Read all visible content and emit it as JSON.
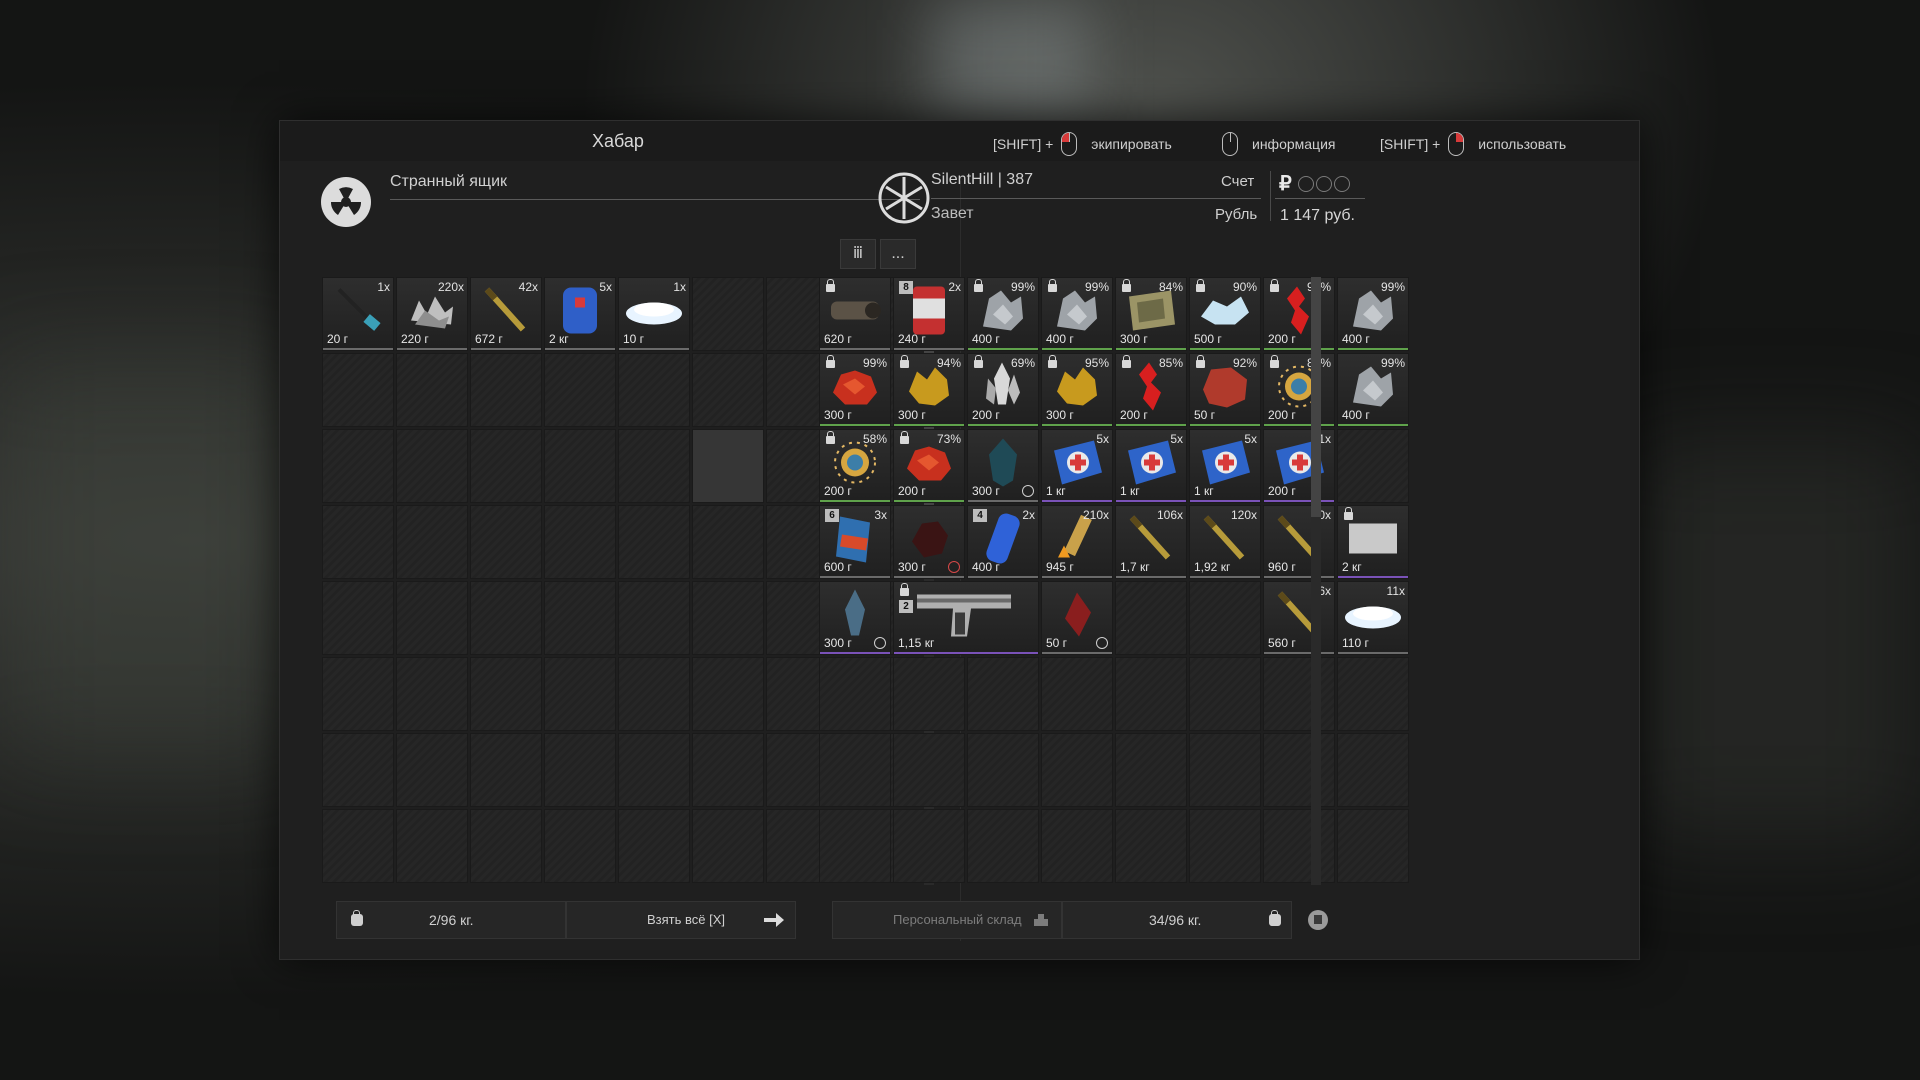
{
  "window": {
    "title": "Хабар",
    "hints": [
      {
        "prefix": "[SHIFT] +",
        "mouse": "left",
        "label": "экипировать"
      },
      {
        "prefix": "",
        "mouse": "none",
        "label": "информация"
      },
      {
        "prefix": "[SHIFT] +",
        "mouse": "right",
        "label": "использовать"
      }
    ]
  },
  "left_panel": {
    "icon": "radiation-icon",
    "name": "Странный ящик",
    "tool_sort": "ⅲ",
    "tool_more": "...",
    "weight": "2/96 кг.",
    "take_all": "Взять всё [X]",
    "items": [
      {
        "qty": "1x",
        "weight": "20 г",
        "kind": "antenna"
      },
      {
        "qty": "220x",
        "weight": "220 г",
        "kind": "scrap"
      },
      {
        "qty": "42x",
        "weight": "672 г",
        "kind": "ammo"
      },
      {
        "qty": "5x",
        "weight": "2 кг",
        "kind": "canister"
      },
      {
        "qty": "1x",
        "weight": "10 г",
        "kind": "salt"
      }
    ]
  },
  "right_panel": {
    "icon": "snowflake-icon",
    "player": "SilentHill | 387",
    "faction": "Завет",
    "account_label": "Счет",
    "currency_label": "Рубль",
    "currency_symbol": "₽",
    "money": "1 147 руб.",
    "storage": "Персональный склад",
    "weight": "34/96 кг.",
    "items": [
      {
        "qty": "",
        "weight": "620 г",
        "lock": true,
        "kind": "scope"
      },
      {
        "qty": "2x",
        "weight": "240 г",
        "badge": "8",
        "kind": "can"
      },
      {
        "qty": "99%",
        "weight": "400 г",
        "lock": true,
        "kind": "rock"
      },
      {
        "qty": "99%",
        "weight": "400 г",
        "lock": true,
        "kind": "rock"
      },
      {
        "qty": "84%",
        "weight": "300 г",
        "lock": true,
        "kind": "map"
      },
      {
        "qty": "90%",
        "weight": "500 г",
        "lock": true,
        "kind": "ice"
      },
      {
        "qty": "92%",
        "weight": "200 г",
        "lock": true,
        "kind": "redcrystal"
      },
      {
        "qty": "99%",
        "weight": "400 г",
        "kind": "rock"
      },
      {
        "qty": "99%",
        "weight": "300 г",
        "lock": true,
        "kind": "redblob"
      },
      {
        "qty": "94%",
        "weight": "300 г",
        "lock": true,
        "kind": "gold"
      },
      {
        "qty": "69%",
        "weight": "200 г",
        "lock": true,
        "kind": "crystal"
      },
      {
        "qty": "95%",
        "weight": "300 г",
        "lock": true,
        "kind": "gold"
      },
      {
        "qty": "85%",
        "weight": "200 г",
        "lock": true,
        "kind": "redcrystal"
      },
      {
        "qty": "92%",
        "weight": "50 г",
        "lock": true,
        "kind": "redrock"
      },
      {
        "qty": "89%",
        "weight": "200 г",
        "lock": true,
        "kind": "spark"
      },
      {
        "qty": "99%",
        "weight": "400 г",
        "kind": "rock"
      },
      {
        "qty": "58%",
        "weight": "200 г",
        "lock": true,
        "kind": "spark"
      },
      {
        "qty": "73%",
        "weight": "200 г",
        "lock": true,
        "kind": "redblob"
      },
      {
        "qty": "",
        "weight": "300 г",
        "clock": true,
        "kind": "shell"
      },
      {
        "qty": "5x",
        "weight": "1 кг",
        "kind": "medkit"
      },
      {
        "qty": "5x",
        "weight": "1 кг",
        "kind": "medkit"
      },
      {
        "qty": "5x",
        "weight": "1 кг",
        "kind": "medkit"
      },
      {
        "qty": "1x",
        "weight": "200 г",
        "kind": "medkit"
      },
      {
        "qty": "",
        "weight": "",
        "kind": "empty"
      },
      {
        "qty": "3x",
        "weight": "600 г",
        "badge": "6",
        "kind": "pack"
      },
      {
        "qty": "",
        "weight": "300 г",
        "clock": true,
        "clockRed": true,
        "kind": "darkrock"
      },
      {
        "qty": "2x",
        "weight": "400 г",
        "badge": "4",
        "kind": "bluecan"
      },
      {
        "qty": "210x",
        "weight": "945 г",
        "kind": "brass"
      },
      {
        "qty": "106x",
        "weight": "1,7 кг",
        "kind": "ammo"
      },
      {
        "qty": "120x",
        "weight": "1,92 кг",
        "kind": "ammo"
      },
      {
        "qty": "60x",
        "weight": "960 г",
        "kind": "ammo"
      },
      {
        "qty": "",
        "weight": "2 кг",
        "lock": true,
        "kind": "grey"
      },
      {
        "qty": "",
        "weight": "300 г",
        "clock": true,
        "kind": "feather"
      },
      {
        "qty": "",
        "weight": "1,15 кг",
        "lock": true,
        "badge": "2",
        "kind": "pistol",
        "wide": true
      },
      {
        "qty": "",
        "weight": "50 г",
        "clock": true,
        "kind": "redleaf"
      },
      {
        "qty": "",
        "weight": "",
        "kind": "empty"
      },
      {
        "qty": "",
        "weight": "",
        "kind": "empty"
      },
      {
        "qty": "56x",
        "weight": "560 г",
        "kind": "ammo"
      },
      {
        "qty": "11x",
        "weight": "110 г",
        "kind": "salt"
      }
    ]
  },
  "colors": {
    "accent_red": "#d83a3a",
    "green_border": "#5fa24b",
    "purple_border": "#7a52b8"
  }
}
